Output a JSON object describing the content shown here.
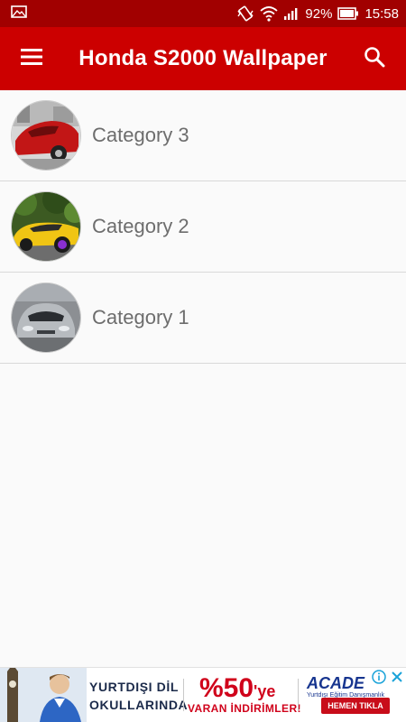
{
  "status_bar": {
    "battery": "92%",
    "time": "15:58",
    "icons": [
      "image-icon",
      "vibrate-icon",
      "wifi-icon",
      "signal-icon",
      "battery-icon"
    ]
  },
  "app_bar": {
    "title": "Honda S2000 Wallpaper",
    "menu_icon": "hamburger-menu-icon",
    "search_icon": "search-icon",
    "color": "#cc0000"
  },
  "categories": [
    {
      "label": "Category 3",
      "thumb_icon": "red-car-thumbnail"
    },
    {
      "label": "Category 2",
      "thumb_icon": "yellow-car-thumbnail"
    },
    {
      "label": "Category 1",
      "thumb_icon": "silver-car-thumbnail"
    }
  ],
  "ad": {
    "line1": "YURTDIŞI DİL",
    "line2": "OKULLARINDA",
    "percent": "%50",
    "percent_suffix": "'ye",
    "subline": "VARAN İNDİRİMLER!",
    "brand": "ACADE",
    "brand_sub": "Yurtdışı Eğitim Danışmanlık",
    "cta": "HEMEN TIKLA",
    "colors": {
      "red": "#d0021b",
      "navy": "#17358f"
    }
  }
}
